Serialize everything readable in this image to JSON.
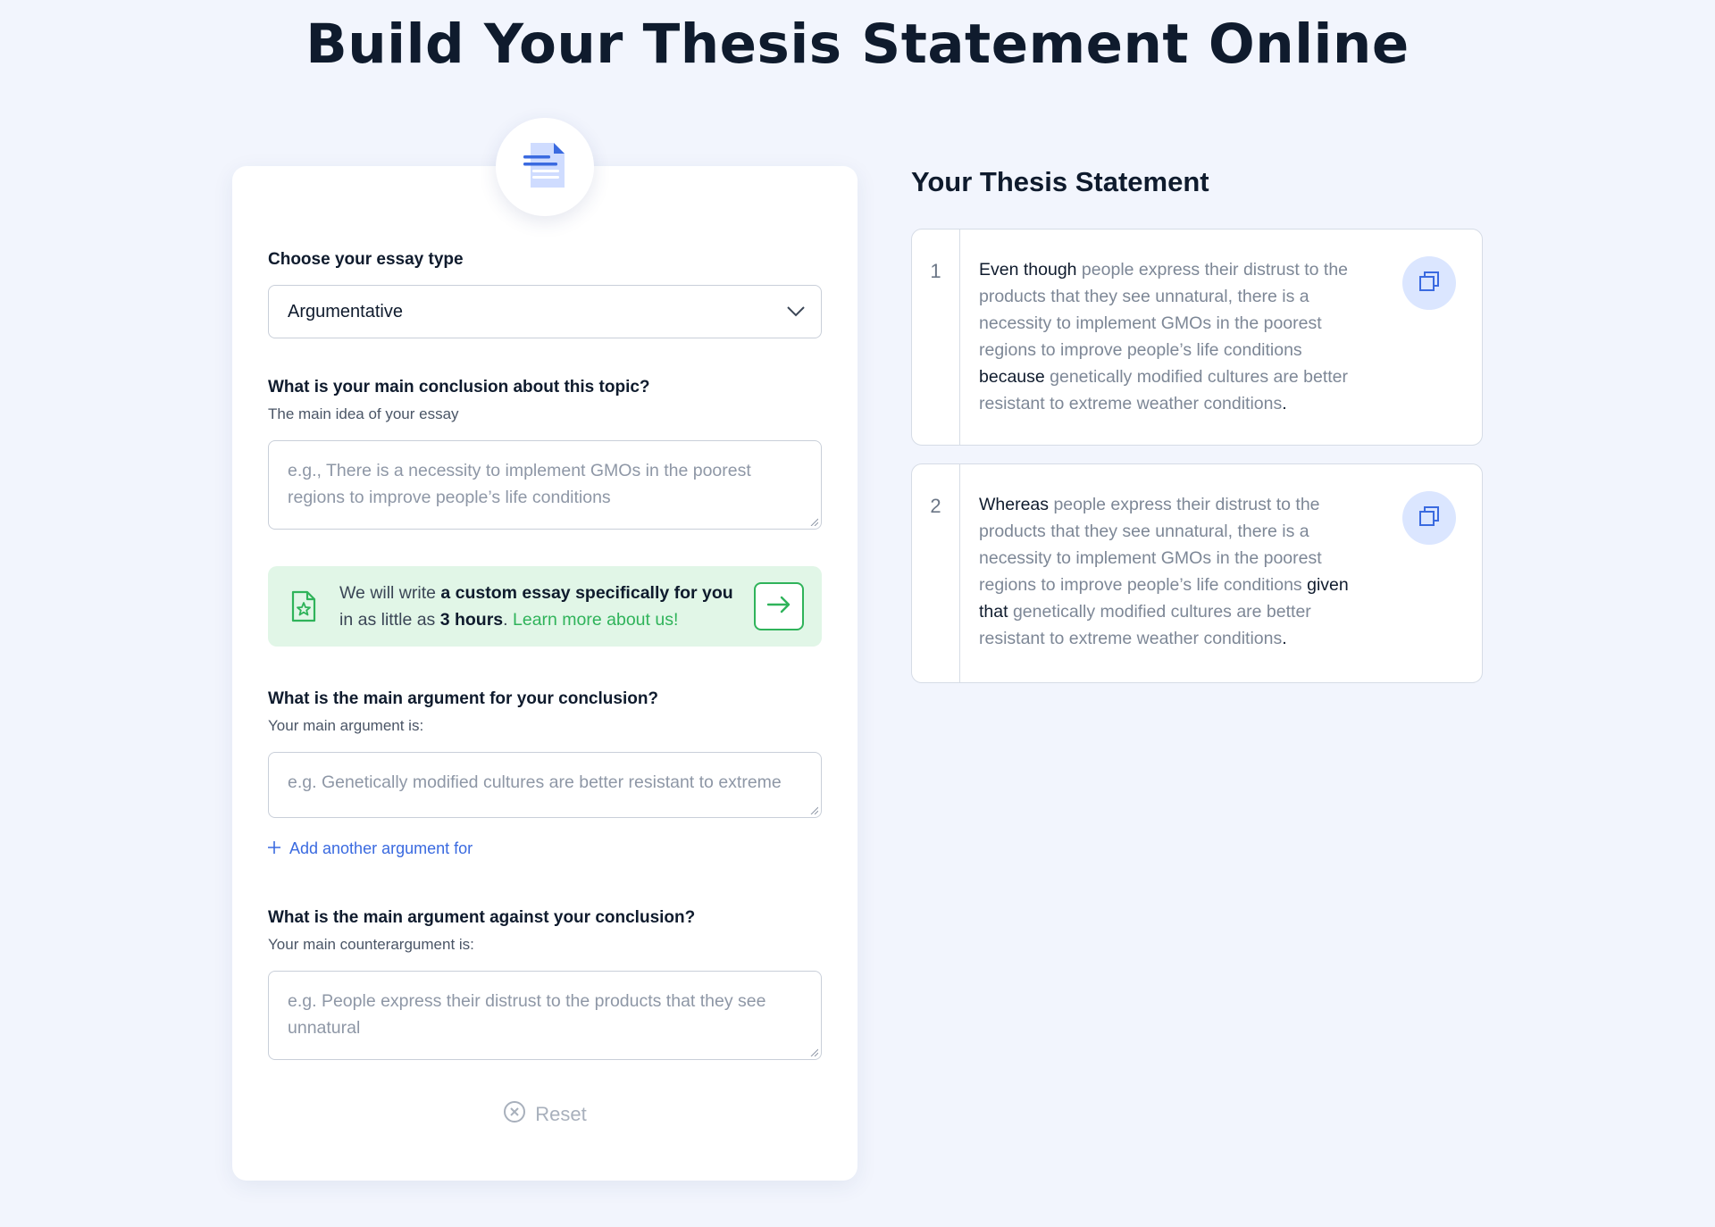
{
  "page": {
    "title": "Build Your Thesis Statement Online"
  },
  "form": {
    "essay_type": {
      "label": "Choose your essay type",
      "value": "Argumentative"
    },
    "conclusion": {
      "label": "What is your main conclusion about this topic?",
      "hint": "The main idea of your essay",
      "placeholder": "e.g., There is a necessity to implement GMOs in the poorest regions to improve people’s life conditions"
    },
    "promo": {
      "text_1": "We will write ",
      "bold_1": "a custom essay specifically for you",
      "text_2": " in as little as ",
      "bold_2": "3 hours",
      "text_3": ". ",
      "link": "Learn more about us!"
    },
    "argument_for": {
      "label": "What is the main argument for your conclusion?",
      "hint": "Your main argument is:",
      "placeholder": "e.g. Genetically modified cultures are better resistant to extreme",
      "add_label": "Add another argument for"
    },
    "argument_against": {
      "label": "What is the main argument against your conclusion?",
      "hint": "Your main counterargument is:",
      "placeholder": "e.g. People express their distrust to the products that they see unnatural"
    },
    "reset_label": "Reset"
  },
  "preview": {
    "title": "Your Thesis Statement",
    "statements": [
      {
        "number": "1",
        "parts": [
          {
            "t": "Even though",
            "kw": true
          },
          {
            "t": " people express their distrust to the products that they see unnatural",
            "kw": false
          },
          {
            "t": ", there is a necessity to implement GMOs in the poorest regions to improve people’s life conditions ",
            "kw": false
          },
          {
            "t": "because",
            "kw": true
          },
          {
            "t": " genetically modified cultures are better resistant to extreme weather conditions",
            "kw": false
          },
          {
            "t": ".",
            "kw": true
          }
        ]
      },
      {
        "number": "2",
        "parts": [
          {
            "t": "Whereas",
            "kw": true
          },
          {
            "t": " people express their distrust to the products that they see unnatural",
            "kw": false
          },
          {
            "t": ", there is a necessity to implement GMOs in the poorest regions to improve people’s life conditions ",
            "kw": false
          },
          {
            "t": "given that",
            "kw": true
          },
          {
            "t": " genetically modified cultures are better resistant to extreme weather conditions",
            "kw": false
          },
          {
            "t": ".",
            "kw": true
          }
        ]
      }
    ]
  },
  "colors": {
    "background": "#f2f5fd",
    "accent_blue": "#3a6ae0",
    "accent_green": "#2fb35a",
    "promo_bg": "#e1f6e7",
    "copy_btn_bg": "#dbe6ff"
  },
  "icons": {
    "badge": "document-icon",
    "select": "chevron-down-icon",
    "promo": "star-document-icon",
    "promo_arrow": "arrow-right-icon",
    "add": "plus-icon",
    "reset": "close-circle-icon",
    "copy": "copy-icon"
  }
}
